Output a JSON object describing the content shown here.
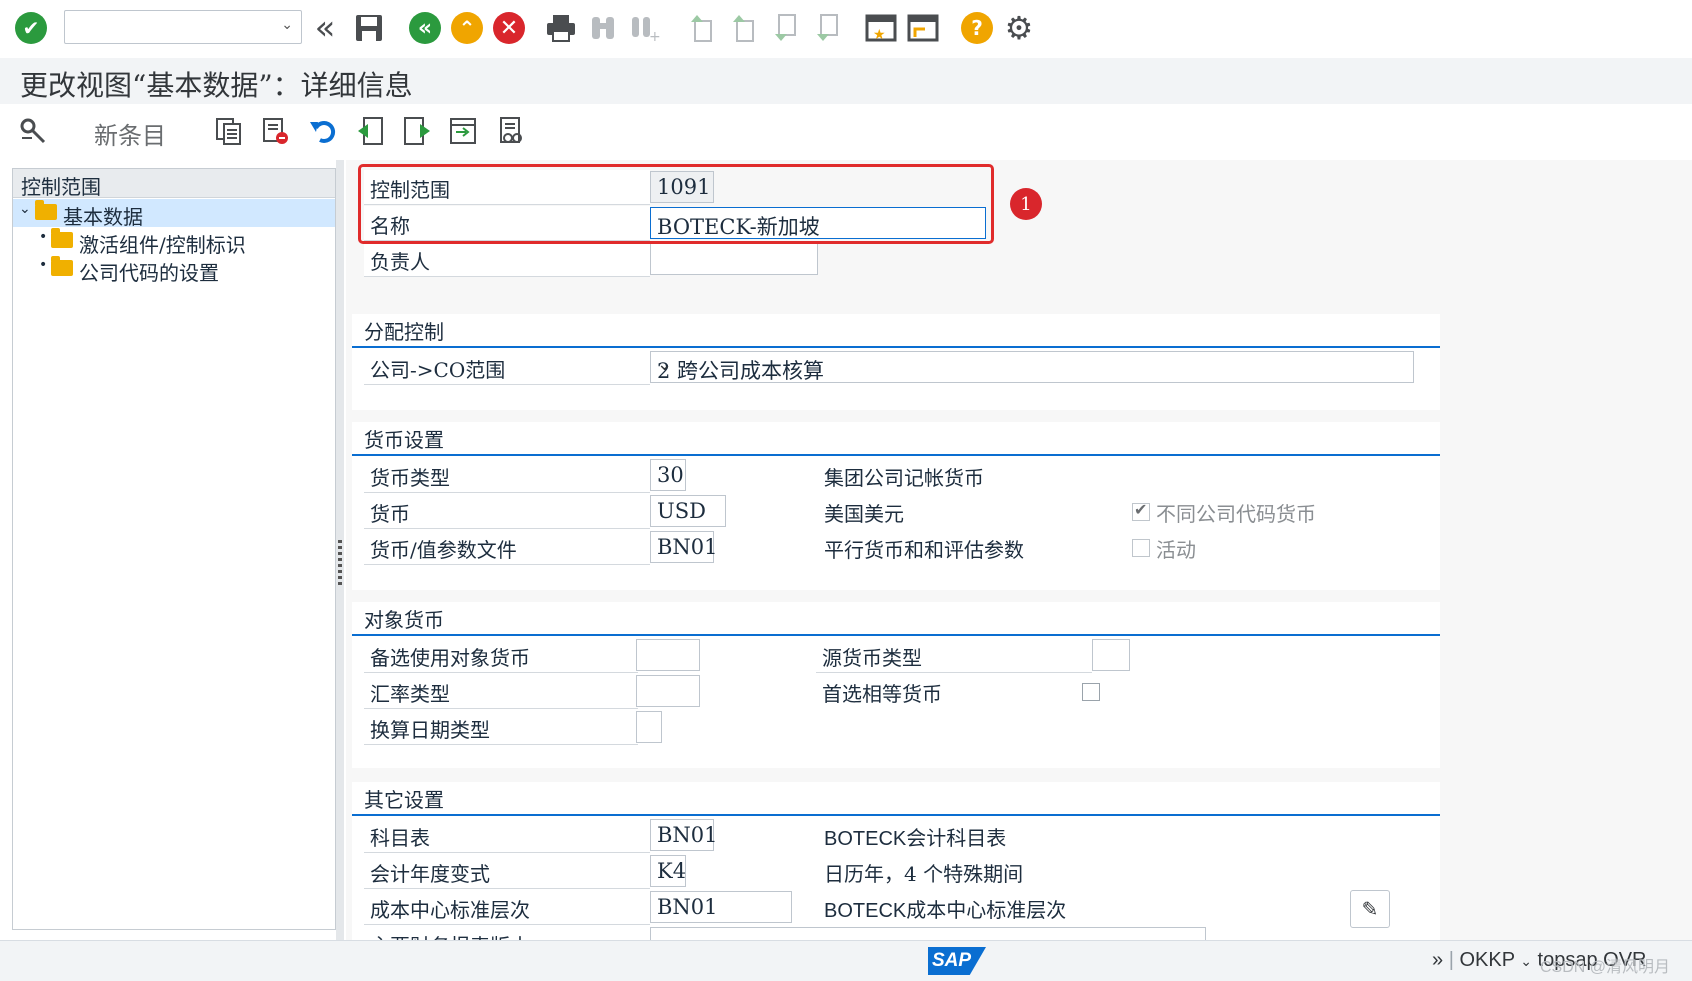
{
  "page": {
    "title": "更改视图“基本数据”：详细信息",
    "new_entries_label": "新条目"
  },
  "toolbar": {
    "command_value": ""
  },
  "tree": {
    "header": "控制范围",
    "items": [
      {
        "label": "基本数据"
      },
      {
        "label": "激活组件/控制标识"
      },
      {
        "label": "公司代码的设置"
      }
    ]
  },
  "header_fields": {
    "controlling_area_label": "控制范围",
    "controlling_area_value": "1091",
    "name_label": "名称",
    "name_value": "BOTECK-新加坡",
    "responsible_label": "负责人",
    "responsible_value": ""
  },
  "annotation": {
    "badge": "1"
  },
  "assignment_control": {
    "title": "分配控制",
    "company_co_label": "公司->CO范围",
    "company_co_value": "2 跨公司成本核算"
  },
  "currency_settings": {
    "title": "货币设置",
    "currency_type_label": "货币类型",
    "currency_type_value": "30",
    "currency_type_text": "集团公司记帐货币",
    "currency_label": "货币",
    "currency_value": "USD",
    "currency_text": "美国美元",
    "diff_cc_currency_label": "不同公司代码货币",
    "diff_cc_currency_checked": true,
    "profile_label": "货币/值参数文件",
    "profile_value": "BN01",
    "profile_text": "平行货币和和评估参数",
    "active_label": "活动",
    "active_checked": false
  },
  "object_currency": {
    "title": "对象货币",
    "alt_object_currency_label": "备选使用对象货币",
    "alt_object_currency_value": "",
    "exchange_rate_type_label": "汇率类型",
    "exchange_rate_type_value": "",
    "translation_date_type_label": "换算日期类型",
    "translation_date_type_value": "",
    "source_currency_type_label": "源货币类型",
    "source_currency_type_value": "",
    "preferred_equal_currency_label": "首选相等货币",
    "preferred_equal_currency_checked": false
  },
  "other_settings": {
    "title": "其它设置",
    "chart_of_accounts_label": "科目表",
    "chart_of_accounts_value": "BN01",
    "chart_of_accounts_text": "BOTECK会计科目表",
    "fiscal_year_variant_label": "会计年度变式",
    "fiscal_year_variant_value": "K4",
    "fiscal_year_variant_text": "日历年，4 个特殊期间",
    "cost_center_hierarchy_label": "成本中心标准层次",
    "cost_center_hierarchy_value": "BN01",
    "cost_center_hierarchy_text": "BOTECK成本中心标准层次",
    "partial_row_label": "主要财务报表版本"
  },
  "status": {
    "sap_logo": "SAP",
    "transaction": "OKKP",
    "system": "topsap",
    "mode": "OVR",
    "watermark": "CSDN @清风明月"
  },
  "colors": {
    "accent": "#0a6ed1",
    "highlight": "#e02b2b",
    "green": "#2b9a3e",
    "orange": "#f0a500",
    "red": "#d9262c"
  }
}
